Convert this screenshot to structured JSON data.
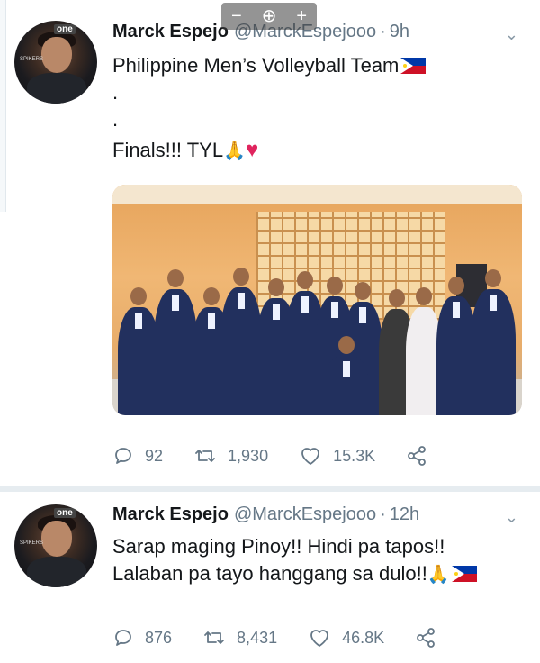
{
  "zoom_toolbar": {
    "minus": "−",
    "zoom": "⊕",
    "plus": "+"
  },
  "tweets": [
    {
      "name": "Marck Espejo",
      "handle": "@MarckEspejooo",
      "time": "9h",
      "lines": [
        "Philippine Men’s Volleyball Team",
        ".",
        ".",
        "Finals!!! TYL"
      ],
      "replies": "92",
      "retweets": "1,930",
      "likes": "15.3K",
      "avatar_logo": "one",
      "avatar_text": "SPIKERS"
    },
    {
      "name": "Marck Espejo",
      "handle": "@MarckEspejooo",
      "time": "12h",
      "lines": [
        "Sarap maging Pinoy!! Hindi pa tapos!!",
        "Lalaban pa tayo hanggang sa dulo!!"
      ],
      "replies": "876",
      "retweets": "8,431",
      "likes": "46.8K",
      "avatar_logo": "one",
      "avatar_text": "SPIKERS"
    }
  ],
  "icons": {
    "reply": "reply-icon",
    "retweet": "retweet-icon",
    "like": "heart-icon",
    "share": "share-icon",
    "caret": "chevron-down-icon"
  },
  "colors": {
    "text": "#14171a",
    "muted": "#657786",
    "heart": "#e0245e"
  }
}
